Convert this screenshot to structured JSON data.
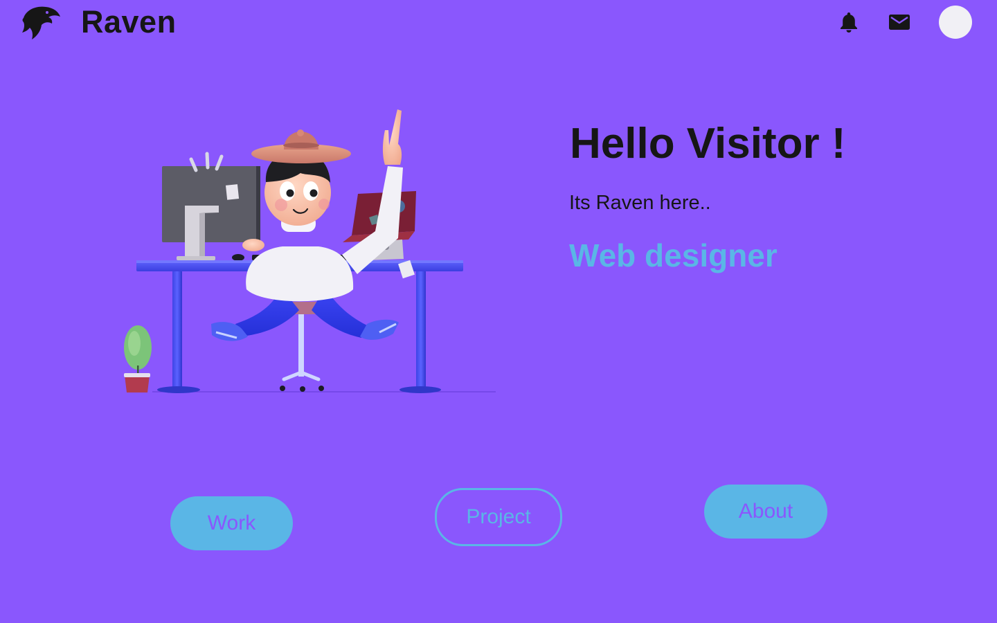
{
  "header": {
    "brand_name": "Raven",
    "logo_icon": "raven-head-icon",
    "notification_icon": "bell-icon",
    "message_icon": "mail-icon"
  },
  "hero": {
    "title": "Hello Visitor !",
    "subtitle": "Its Raven here..",
    "role": "Web designer"
  },
  "nav": {
    "work_label": "Work",
    "project_label": "Project",
    "about_label": "About"
  },
  "colors": {
    "background": "#8a57fd",
    "accent": "#5ab6e6",
    "text": "#161616",
    "avatar": "#f1f0f5"
  }
}
